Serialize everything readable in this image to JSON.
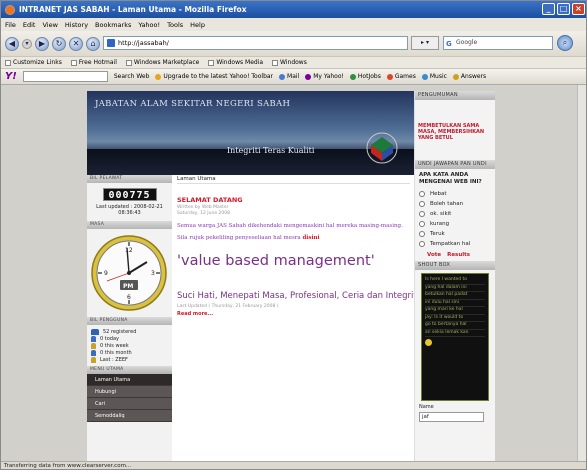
{
  "window": {
    "title": "INTRANET JAS SABAH - Laman Utama - Mozilla Firefox"
  },
  "menubar": [
    "File",
    "Edit",
    "View",
    "History",
    "Bookmarks",
    "Yahoo!",
    "Tools",
    "Help"
  ],
  "address": {
    "url": "http://jassabah/"
  },
  "search": {
    "engine": "G",
    "placeholder": "Google"
  },
  "bookmarks": [
    "Customize Links",
    "Free Hotmail",
    "Windows Marketplace",
    "Windows Media",
    "Windows"
  ],
  "yahoo_toolbar": {
    "logo": "Y!",
    "items": [
      "Search Web",
      "Upgrade to the latest Yahoo! Toolbar",
      "Mail",
      "My Yahoo!",
      "HotJobs",
      "Games",
      "Music",
      "Answers"
    ]
  },
  "banner": {
    "title": "JABATAN ALAM SEKITAR NEGERI SABAH",
    "slogan": "Integriti Teras Kualiti"
  },
  "left": {
    "counter_head": "BIL PELAWAT",
    "counter": "000775",
    "last_updated": "Last updated : 2008-02-21 08:36:43",
    "clock_head": "MASA",
    "clock_label": "PM",
    "users_head": "BIL PENGGUNA",
    "users": [
      "52 registered",
      "0 today",
      "0 this week",
      "0 this month",
      "Last : ZEEF"
    ],
    "menu_head": "MENU UTAMA",
    "menu": [
      "Laman Utama",
      "Hubungi",
      "Cari",
      "Semoddaliq"
    ]
  },
  "main": {
    "crumb": "Laman Utama",
    "welcome": "SELAMAT DATANG",
    "by": "Written by Web Master\nSaturday, 12 June 2008",
    "intro": "Semua warga JAS Sabah dikehendaki mengemaskini hal mereka masing-masing.",
    "intro2_pre": "Sila rujuk pekeliling penyeseliaan hal mesra ",
    "intro2_link": "disini",
    "value_title": "'value based management'",
    "suci": "Suci Hati, Menepati Masa, Profesional, Ceria dan Integriti",
    "last_updated": "Last Updated ( Thursday, 21 February 2008 )",
    "read_more": "Read more..."
  },
  "right": {
    "pengumuman_head": "PENGUMUMAN",
    "pengumuman": "MEMBETULKAN SAMA MASA, MEMBERSIHKAN YANG BETUL",
    "poll_head": "UNDI JAWAPAN PAN UNDI",
    "poll_question": "APA KATA ANDA MENGENAI WEB INI?",
    "poll_options": [
      "Hebat",
      "Boleh tahan",
      "ok. sikit",
      "kurang",
      "Teruk",
      "Tempatkan hal"
    ],
    "vote": "Vote",
    "results": "Results",
    "shout_head": "SHOUT BOX",
    "shouts": [
      "Is here I wanted to",
      "yang hal dalam ini",
      "betulkan hal padat",
      "ini dulu hal sini",
      "yang mari ke hal",
      "jay: Is it would to",
      "go to bertanya hal",
      "an sekia lemak kan"
    ],
    "name_label": "Name",
    "name_value": "jaf"
  },
  "status": "Transferring data from www.clearserver.com..."
}
